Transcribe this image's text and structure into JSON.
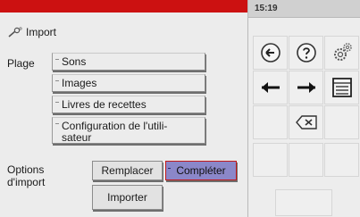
{
  "panel": {
    "title": "Import",
    "title_icon": "wrench-icon"
  },
  "plage": {
    "label": "Plage",
    "items": [
      "Sons",
      "Images",
      "Livres de recettes",
      "Configuration de l'utili-\nsateur"
    ]
  },
  "options": {
    "label": "Options\nd'import",
    "replace_label": "Remplacer",
    "complete_label": "Compléter",
    "selected": "Compléter",
    "import_label": "Importer"
  },
  "status": {
    "time": "15:19"
  },
  "toolbar": {
    "icons": [
      "back-icon",
      "help-icon",
      "settings-gears-icon",
      "arrow-left-icon",
      "arrow-right-icon",
      "window-icon",
      "backspace-icon"
    ]
  },
  "colors": {
    "top_bar": "#cc1111",
    "selected_button": "#8b87c9",
    "selected_border": "#c21a1a"
  }
}
